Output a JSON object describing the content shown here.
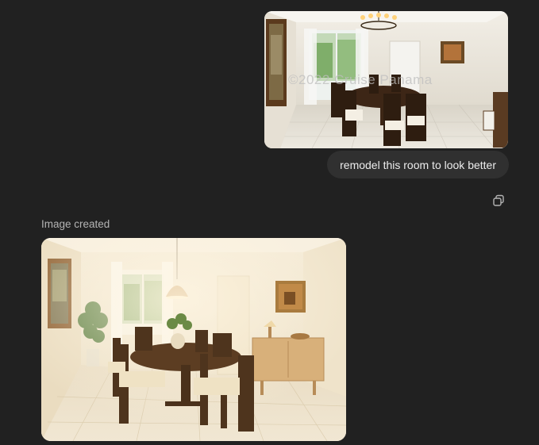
{
  "conversation": {
    "user_message": {
      "text": "remodel this room to look better",
      "image_watermark": "©2022 Cruise Panama",
      "image_icon": "dining-room-photo-icon"
    },
    "copy_icon": "copy-icon",
    "assistant_message": {
      "status_label": "Image created",
      "image_icon": "remodeled-dining-room-icon"
    }
  },
  "colors": {
    "background": "#212121",
    "bubble": "#303030",
    "text_primary": "#ececec",
    "text_secondary": "#b4b4b4"
  }
}
